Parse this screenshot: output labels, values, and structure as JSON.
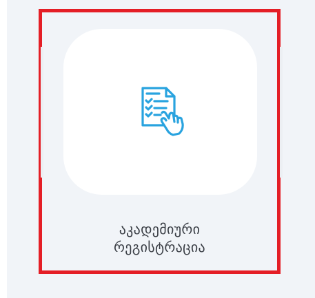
{
  "tile": {
    "icon": "checklist-document-hand-icon",
    "label_line1": "აკადემიური",
    "label_line2": "რეგისტრაცია"
  },
  "colors": {
    "highlight_border": "#e41e26",
    "icon_stroke": "#29a3df",
    "background": "#f1f4f8",
    "icon_box": "#ffffff",
    "label_text": "#3a3e45"
  }
}
